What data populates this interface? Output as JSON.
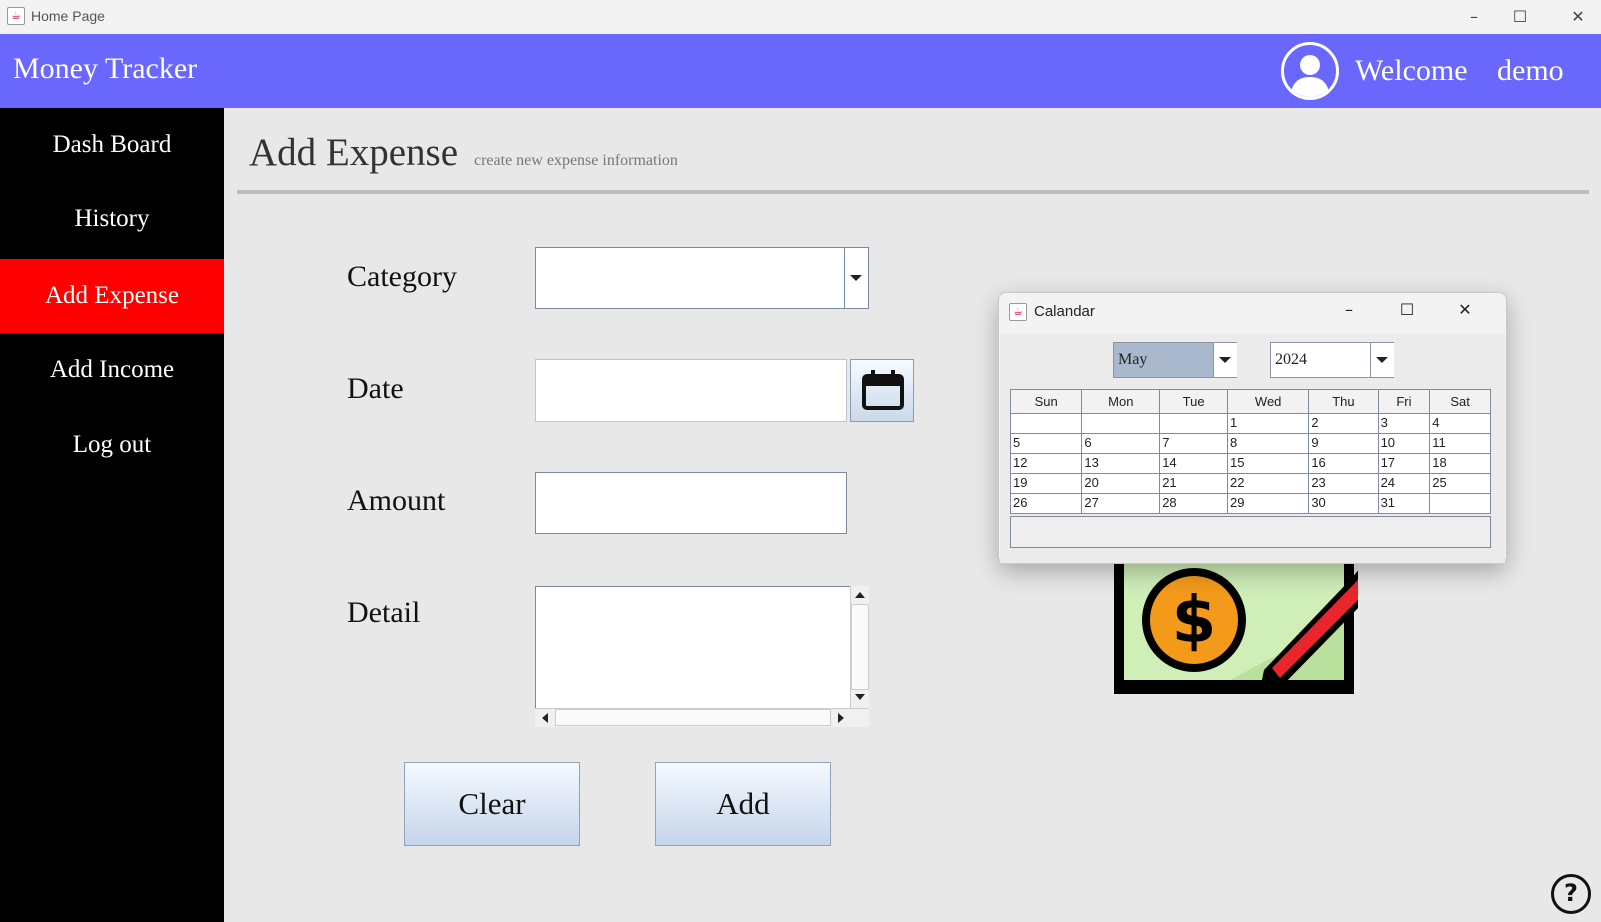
{
  "window": {
    "title": "Home Page",
    "minimize": "–",
    "maximize": "☐",
    "close": "✕"
  },
  "header": {
    "app_title": "Money Tracker",
    "welcome": "Welcome",
    "username": "demo",
    "background": "#6a67fd"
  },
  "sidebar": {
    "items": [
      {
        "label": "Dash Board",
        "active": false
      },
      {
        "label": "History",
        "active": false
      },
      {
        "label": "Add Expense",
        "active": true
      },
      {
        "label": "Add Income",
        "active": false
      },
      {
        "label": "Log out",
        "active": false
      }
    ],
    "active_color": "#ff0000"
  },
  "page": {
    "title": "Add Expense",
    "subtitle": "create new expense information"
  },
  "form": {
    "category_label": "Category",
    "category_value": "",
    "date_label": "Date",
    "date_value": "",
    "amount_label": "Amount",
    "amount_value": "",
    "detail_label": "Detail",
    "detail_value": ""
  },
  "buttons": {
    "clear": "Clear",
    "add": "Add"
  },
  "calendar": {
    "title": "Calandar",
    "month": "May",
    "year": "2024",
    "weekdays": [
      "Sun",
      "Mon",
      "Tue",
      "Wed",
      "Thu",
      "Fri",
      "Sat"
    ],
    "weeks": [
      [
        "",
        "",
        "",
        "1",
        "2",
        "3",
        "4"
      ],
      [
        "5",
        "6",
        "7",
        "8",
        "9",
        "10",
        "11"
      ],
      [
        "12",
        "13",
        "14",
        "15",
        "16",
        "17",
        "18"
      ],
      [
        "19",
        "20",
        "21",
        "22",
        "23",
        "24",
        "25"
      ],
      [
        "26",
        "27",
        "28",
        "29",
        "30",
        "31",
        ""
      ]
    ],
    "controls": {
      "minimize": "–",
      "maximize": "☐",
      "close": "✕"
    }
  },
  "help": {
    "label": "?"
  },
  "icons": [
    "app-icon",
    "avatar-icon",
    "calendar-icon",
    "dollar-coin-icon",
    "pencil-icon",
    "help-icon"
  ]
}
